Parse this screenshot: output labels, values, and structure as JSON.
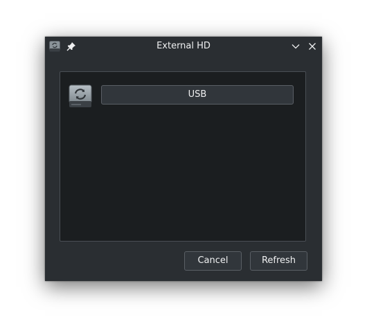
{
  "window": {
    "title": "External HD",
    "app_icon": "external-drive-icon",
    "pin_icon": "pin-icon",
    "minimize_icon": "chevron-down-icon",
    "close_icon": "close-icon"
  },
  "content": {
    "drive_icon": "external-drive-icon",
    "device_button_label": "USB"
  },
  "footer": {
    "cancel_label": "Cancel",
    "refresh_label": "Refresh"
  },
  "colors": {
    "window_bg": "#2a2e32",
    "content_bg": "#1b1e20",
    "button_bg": "#31363b",
    "text": "#eff0f1"
  }
}
